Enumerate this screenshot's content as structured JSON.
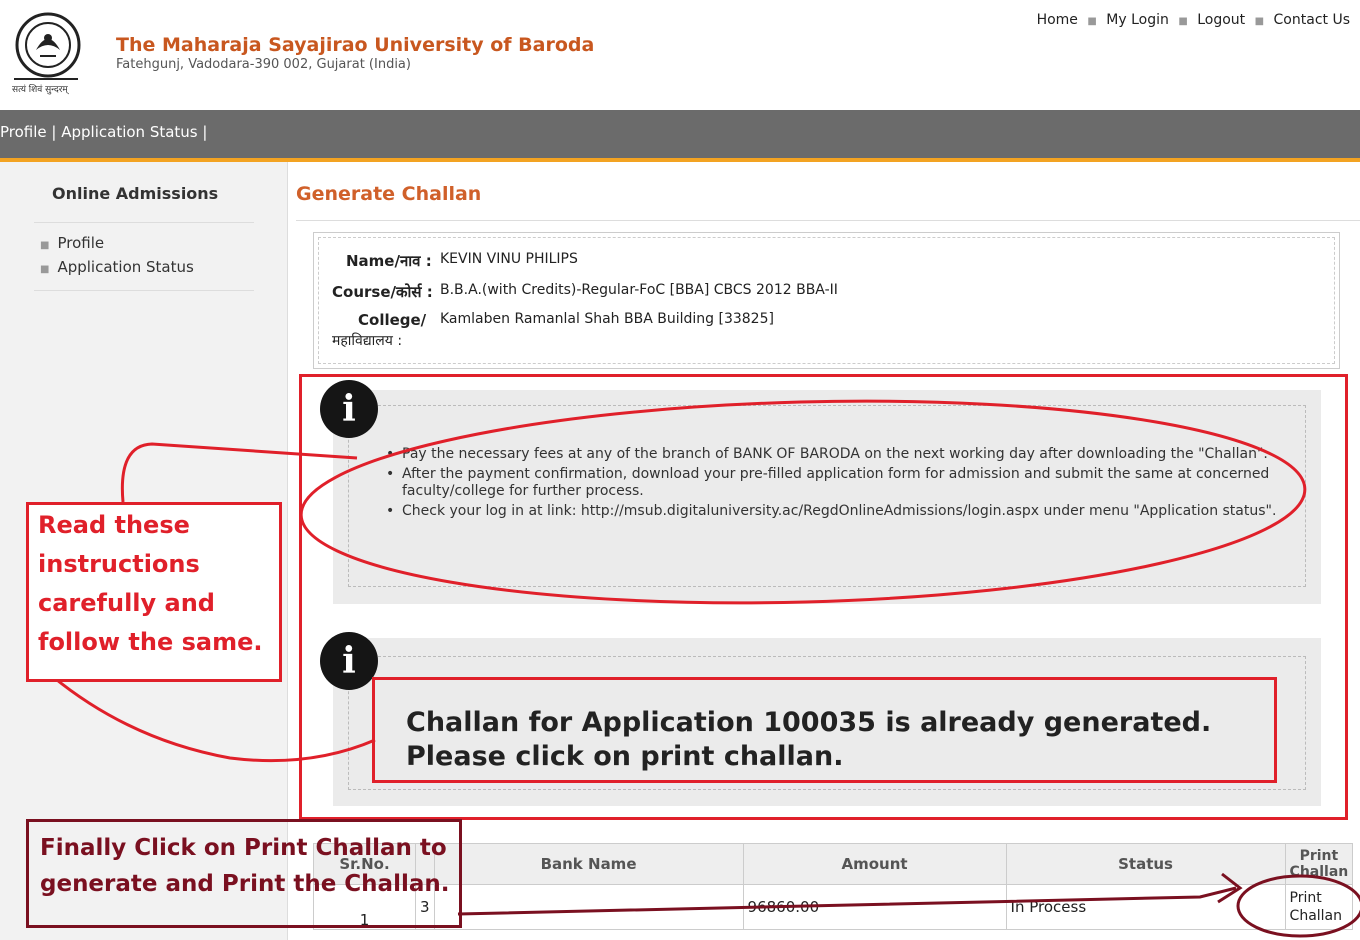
{
  "header": {
    "university_name": "The Maharaja Sayajirao University of Baroda",
    "address": "Fatehgunj, Vadodara-390 002, Gujarat (India)",
    "motto": "सत्यं शिवं सुन्दरम्",
    "top_links": [
      "Home",
      "My Login",
      "Logout",
      "Contact Us"
    ]
  },
  "navbar": {
    "items": [
      "Profile",
      "Application Status"
    ]
  },
  "sidebar": {
    "title": "Online Admissions",
    "items": [
      "Profile",
      "Application Status"
    ]
  },
  "page": {
    "title": "Generate Challan"
  },
  "applicant": {
    "name_label": "Name/नाव",
    "name_value": "KEVIN VINU PHILIPS",
    "course_label": "Course/कोर्स",
    "course_value": "B.B.A.(with Credits)-Regular-FoC [BBA] CBCS 2012 BBA-II",
    "college_label_1": "College/",
    "college_label_2": "महाविद्यालय",
    "college_value": "Kamlaben Ramanlal Shah BBA Building [33825]"
  },
  "instructions": [
    "Pay the necessary fees at any of the branch of BANK OF BARODA on the next working day after downloading the \"Challan\".",
    "After the payment confirmation, download your pre-filled application form for admission and submit the same at concerned faculty/college for further process.",
    "Check your log in at link: http://msub.digitaluniversity.ac/RegdOnlineAdmissions/login.aspx under menu \"Application status\"."
  ],
  "message": {
    "line1": "Challan for Application 100035 is already generated.",
    "line2": "Please click on print challan."
  },
  "annotations": {
    "read_lines": [
      "Read these",
      "instructions",
      "carefully and",
      "follow the same."
    ],
    "final_lines": [
      "Finally Click on Print Challan to",
      "generate and Print the Challan."
    ]
  },
  "table": {
    "headers": [
      "Sr.No.",
      "",
      "Bank Name",
      "Amount",
      "Status",
      "Print Challan"
    ],
    "rows": [
      {
        "sr": "1",
        "code": "3",
        "bank": "",
        "amount": "96860.00",
        "status": "In Process",
        "action": "Print Challan"
      }
    ]
  },
  "colors": {
    "accent": "#d0602a",
    "annotation_red": "#e0202a",
    "annotation_dark": "#7a1020",
    "nav_bg": "#6b6b6b",
    "nav_border": "#f3a322"
  },
  "icons": {
    "info": "info-icon",
    "logo": "university-seal-logo"
  }
}
